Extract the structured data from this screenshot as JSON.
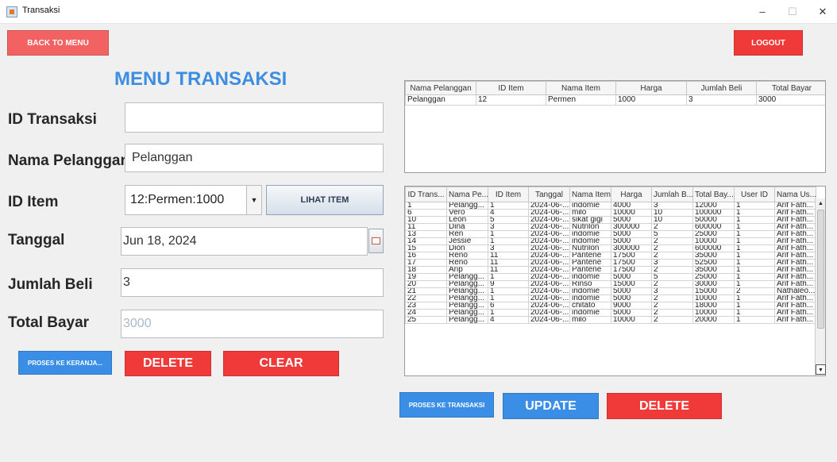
{
  "window": {
    "title": "Transaksi",
    "minimize": "–",
    "maximize": "☐",
    "close": "✕"
  },
  "buttons": {
    "back": "BACK TO MENU",
    "logout": "LOGOUT",
    "lihat_item": "LIHAT ITEM",
    "proses_keranjang": "PROSES KE KERANJA...",
    "delete_left": "DELETE",
    "clear": "CLEAR",
    "proses_transaksi": "PROSES KE TRANSAKSI",
    "update": "UPDATE",
    "delete_right": "DELETE"
  },
  "form": {
    "title": "MENU TRANSAKSI",
    "labels": {
      "id_transaksi": "ID Transaksi",
      "nama_pelanggan": "Nama Pelanggan",
      "id_item": "ID Item",
      "tanggal": "Tanggal",
      "jumlah_beli": "Jumlah Beli",
      "total_bayar": "Total Bayar"
    },
    "values": {
      "id_transaksi": "",
      "nama_pelanggan": "Pelanggan",
      "id_item": "12:Permen:1000",
      "tanggal": "Jun 18, 2024",
      "jumlah_beli": "3",
      "total_bayar": "3000"
    }
  },
  "cart_table": {
    "headers": [
      "Nama Pelanggan",
      "ID Item",
      "Nama Item",
      "Harga",
      "Jumlah Beli",
      "Total Bayar"
    ],
    "rows": [
      [
        "Pelanggan",
        "12",
        "Permen",
        "1000",
        "3",
        "3000"
      ]
    ]
  },
  "transaction_table": {
    "headers": [
      "ID Trans...",
      "Nama Pe...",
      "ID Item",
      "Tanggal",
      "Nama Item",
      "Harga",
      "Jumlah B...",
      "Total Bay...",
      "User ID",
      "Nama Us..."
    ],
    "rows": [
      [
        "1",
        "Pelangg...",
        "1",
        "2024-06-...",
        "indomie",
        "4000",
        "3",
        "12000",
        "1",
        "Arif Fath..."
      ],
      [
        "6",
        "Vero",
        "4",
        "2024-06-...",
        "milo",
        "10000",
        "10",
        "100000",
        "1",
        "Arif Fath..."
      ],
      [
        "10",
        "Leon",
        "5",
        "2024-06-...",
        "sikat gigi",
        "5000",
        "10",
        "50000",
        "1",
        "Arif Fath..."
      ],
      [
        "11",
        "Dina",
        "3",
        "2024-06-...",
        "Nutrilon",
        "300000",
        "2",
        "600000",
        "1",
        "Arif Fath..."
      ],
      [
        "13",
        "Ren",
        "1",
        "2024-06-...",
        "indomie",
        "5000",
        "5",
        "25000",
        "1",
        "Arif Fath..."
      ],
      [
        "14",
        "Jessie",
        "1",
        "2024-06-...",
        "indomie",
        "5000",
        "2",
        "10000",
        "1",
        "Arif Fath..."
      ],
      [
        "15",
        "Dion",
        "3",
        "2024-06-...",
        "Nutrilon",
        "300000",
        "2",
        "600000",
        "1",
        "Arif Fath..."
      ],
      [
        "16",
        "Reno",
        "11",
        "2024-06-...",
        "Pantene",
        "17500",
        "2",
        "35000",
        "1",
        "Arif Fath..."
      ],
      [
        "17",
        "Reno",
        "11",
        "2024-06-...",
        "Pantene",
        "17500",
        "3",
        "52500",
        "1",
        "Arif Fath..."
      ],
      [
        "18",
        "Arip",
        "11",
        "2024-06-...",
        "Pantene",
        "17500",
        "2",
        "35000",
        "1",
        "Arif Fath..."
      ],
      [
        "19",
        "Pelangg...",
        "1",
        "2024-06-...",
        "indomie",
        "5000",
        "5",
        "25000",
        "1",
        "Arif Fath..."
      ],
      [
        "20",
        "Pelangg...",
        "9",
        "2024-06-...",
        "Rinso",
        "15000",
        "2",
        "30000",
        "1",
        "Arif Fath..."
      ],
      [
        "21",
        "Pelangg...",
        "1",
        "2024-06-...",
        "indomie",
        "5000",
        "3",
        "15000",
        "2",
        "Nathaleo..."
      ],
      [
        "22",
        "Pelangg...",
        "1",
        "2024-06-...",
        "indomie",
        "5000",
        "2",
        "10000",
        "1",
        "Arif Fath..."
      ],
      [
        "23",
        "Pelangg...",
        "6",
        "2024-06-...",
        "chitato",
        "9000",
        "2",
        "18000",
        "1",
        "Arif Fath..."
      ],
      [
        "24",
        "Pelangg...",
        "1",
        "2024-06-...",
        "indomie",
        "5000",
        "2",
        "10000",
        "1",
        "Arif Fath..."
      ],
      [
        "25",
        "Pelangg...",
        "4",
        "2024-06-...",
        "milo",
        "10000",
        "2",
        "20000",
        "1",
        "Arif Fath..."
      ]
    ]
  },
  "icons": {
    "combo_arrow": "▼",
    "scroll_up": "▲",
    "scroll_down": "▼"
  },
  "colors": {
    "title_blue": "#3d8ee1",
    "button_red": "#f03a3a",
    "button_blue": "#3a8ee6"
  }
}
